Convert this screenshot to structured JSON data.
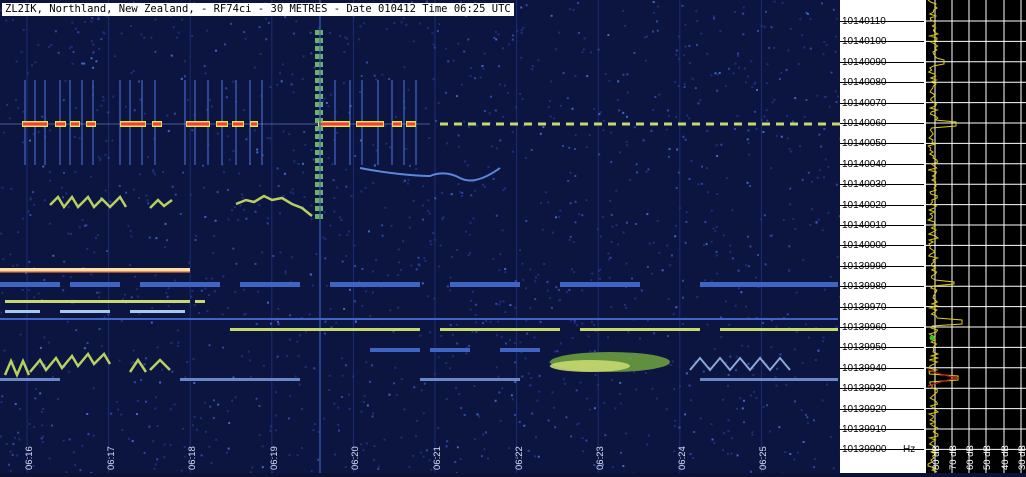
{
  "header": {
    "title": "ZL2IK, Northland, New Zealand, - RF74ci - 30 METRES - Date 010412 Time 06:25 UTC"
  },
  "time_axis": {
    "labels": [
      "06:16",
      "06:17",
      "06:18",
      "06:19",
      "06:20",
      "06:21",
      "06:22",
      "06:23",
      "06:24",
      "06:25"
    ]
  },
  "freq_axis": {
    "labels": [
      "10140110",
      "10140100",
      "10140090",
      "10140080",
      "10140070",
      "10140060",
      "10140050",
      "10140040",
      "10140030",
      "10140020",
      "10140010",
      "10140000",
      "10139990",
      "10139980",
      "10139970",
      "10139960",
      "10139950",
      "10139940",
      "10139930",
      "10139920",
      "10139910",
      "10139900"
    ],
    "unit": "Hz"
  },
  "spectrum": {
    "db_labels": [
      "80 dB",
      "70 dB",
      "60 dB",
      "50 dB",
      "40 dB",
      "30 dB"
    ]
  },
  "colors": {
    "waterfall_bg": "#0c1440",
    "signal_strong": "#ff2020",
    "signal_mid": "#e8e840",
    "signal_weak": "#3a5fc0",
    "grid": "#ffffff",
    "spectrum_trace": "#e0d000"
  }
}
